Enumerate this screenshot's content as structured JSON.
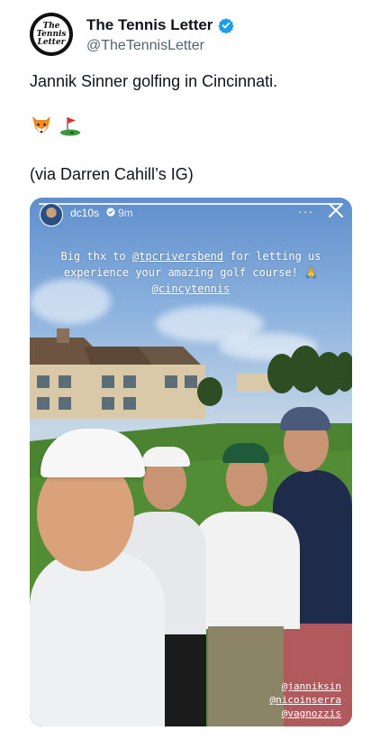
{
  "author": {
    "display_name": "The Tennis Letter",
    "handle": "@TheTennisLetter",
    "avatar_text": [
      "The",
      "Tennis",
      "Letter"
    ]
  },
  "tweet": {
    "text": "Jannik Sinner golfing in Cincinnati.",
    "emojis": [
      "🦊",
      "⛳"
    ],
    "via": "(via Darren Cahill’s IG)"
  },
  "story": {
    "user": "dc10s",
    "time": "9m",
    "more_glyph": "···",
    "caption_part1": "Big thx to ",
    "caption_mention1": "@tpcriversbend",
    "caption_part2": " for letting us experience your amazing golf course! ",
    "caption_emoji": "🙏",
    "caption_mention2": "@cincytennis",
    "tags": [
      "@janniksin",
      "@nicoinserra",
      "@vagnozzis"
    ]
  },
  "colors": {
    "verified": "#1d9bf0",
    "handle": "#536471",
    "text": "#0f1419"
  }
}
